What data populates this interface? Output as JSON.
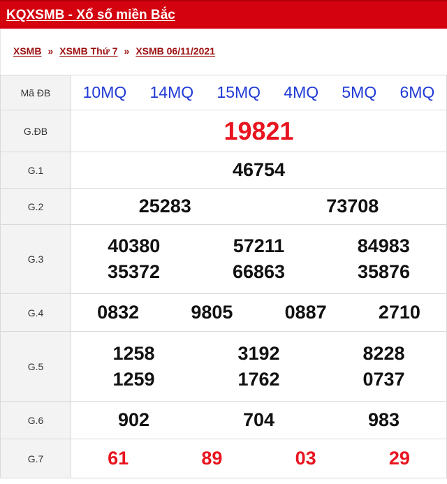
{
  "header": {
    "title": "KQXSMB - Xổ số miền Bắc"
  },
  "breadcrumb": {
    "items": [
      "XSMB",
      "XSMB Thứ 7",
      "XSMB 06/11/2021"
    ],
    "separator": "»"
  },
  "colors": {
    "brand_red": "#d3020e",
    "number_red": "#e8141f",
    "code_blue": "#1f39d6"
  },
  "results": {
    "ma_db": {
      "label": "Mã ĐB",
      "codes": [
        "10MQ",
        "14MQ",
        "15MQ",
        "4MQ",
        "5MQ",
        "6MQ"
      ]
    },
    "g_db": {
      "label": "G.ĐB",
      "numbers": [
        "19821"
      ]
    },
    "g1": {
      "label": "G.1",
      "numbers": [
        "46754"
      ]
    },
    "g2": {
      "label": "G.2",
      "numbers": [
        "25283",
        "73708"
      ]
    },
    "g3": {
      "label": "G.3",
      "numbers": [
        "40380",
        "57211",
        "84983",
        "35372",
        "66863",
        "35876"
      ]
    },
    "g4": {
      "label": "G.4",
      "numbers": [
        "0832",
        "9805",
        "0887",
        "2710"
      ]
    },
    "g5": {
      "label": "G.5",
      "numbers": [
        "1258",
        "3192",
        "8228",
        "1259",
        "1762",
        "0737"
      ]
    },
    "g6": {
      "label": "G.6",
      "numbers": [
        "902",
        "704",
        "983"
      ]
    },
    "g7": {
      "label": "G.7",
      "numbers": [
        "61",
        "89",
        "03",
        "29"
      ]
    }
  }
}
